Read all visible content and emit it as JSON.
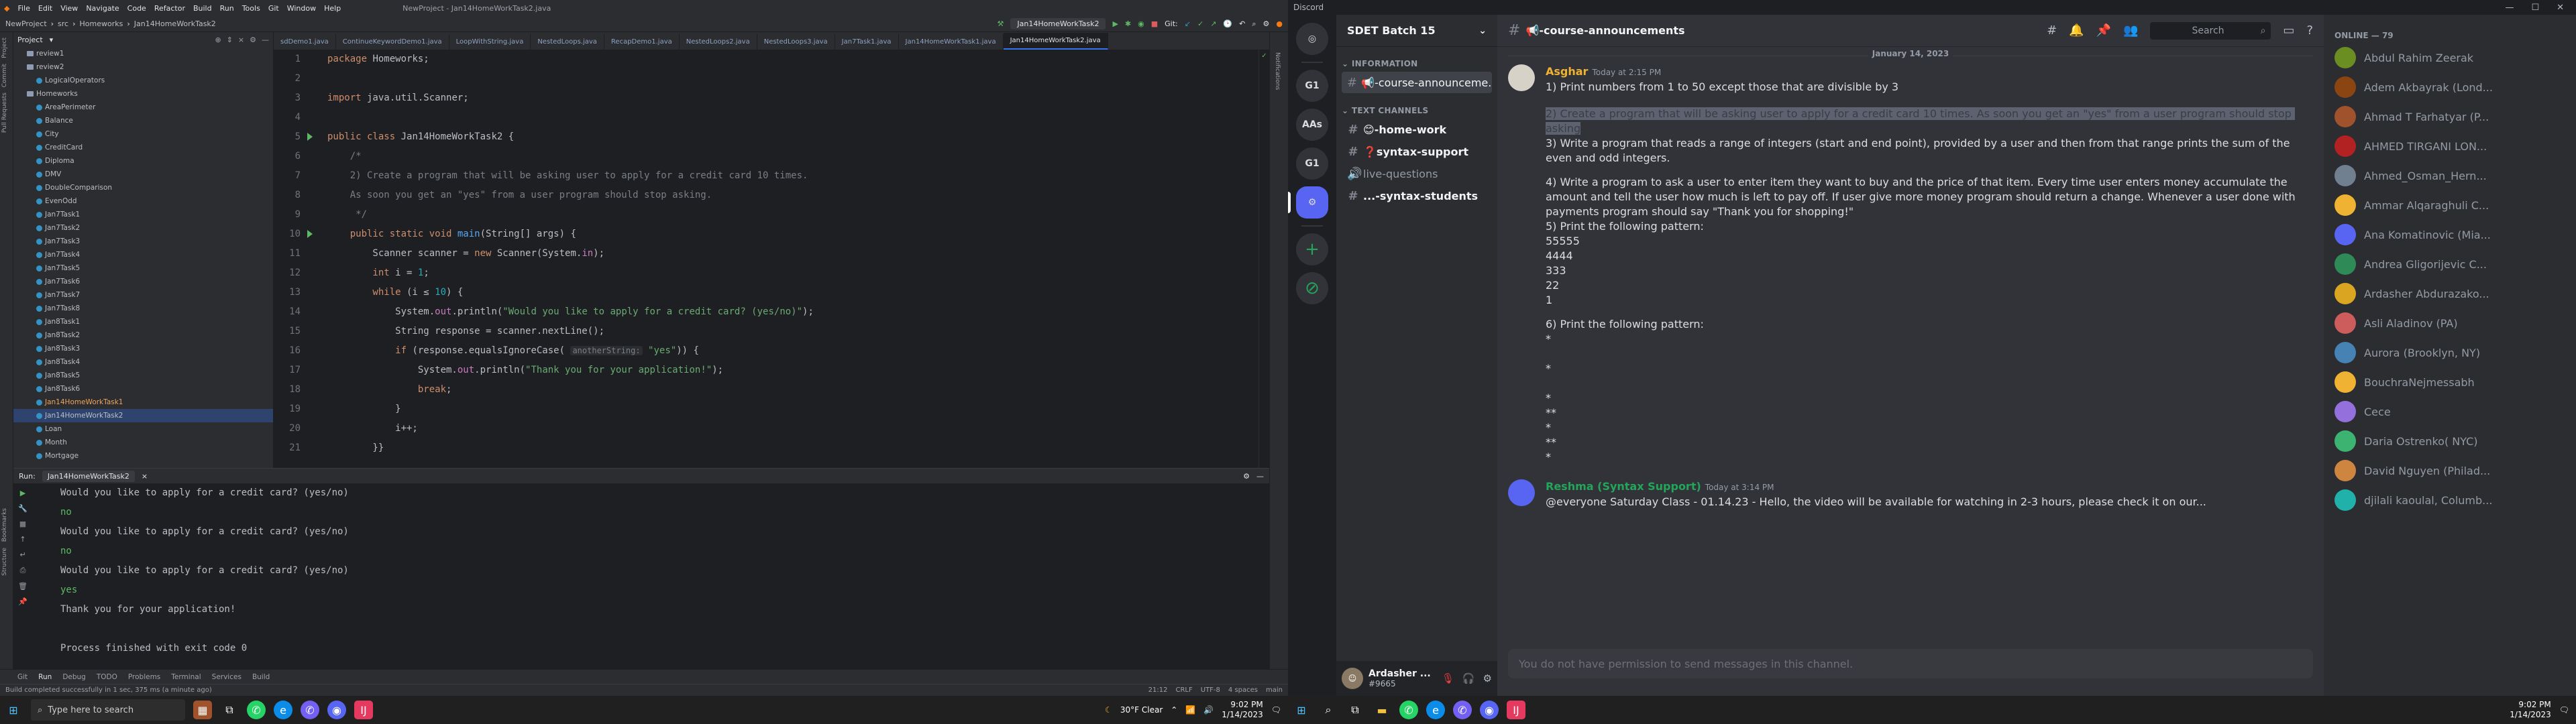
{
  "ide": {
    "window_title": "NewProject - Jan14HomeWorkTask2.java",
    "menu": [
      "File",
      "Edit",
      "View",
      "Navigate",
      "Code",
      "Refactor",
      "Build",
      "Run",
      "Tools",
      "Git",
      "Window",
      "Help"
    ],
    "breadcrumb": [
      "NewProject",
      "src",
      "Homeworks",
      "Jan14HomeWorkTask2"
    ],
    "run_config": "Jan14HomeWorkTask2",
    "git_label": "Git:",
    "project_label": "Project",
    "tree": [
      {
        "name": "review1",
        "type": "folder",
        "indent": 2
      },
      {
        "name": "review2",
        "type": "folder",
        "indent": 2
      },
      {
        "name": "LogicalOperators",
        "type": "file",
        "indent": 4
      },
      {
        "name": "Homeworks",
        "type": "folder",
        "indent": 2
      },
      {
        "name": "AreaPerimeter",
        "type": "file",
        "indent": 4
      },
      {
        "name": "Balance",
        "type": "file",
        "indent": 4
      },
      {
        "name": "City",
        "type": "file",
        "indent": 4
      },
      {
        "name": "CreditCard",
        "type": "file",
        "indent": 4
      },
      {
        "name": "Diploma",
        "type": "file",
        "indent": 4
      },
      {
        "name": "DMV",
        "type": "file",
        "indent": 4
      },
      {
        "name": "DoubleComparison",
        "type": "file",
        "indent": 4
      },
      {
        "name": "EvenOdd",
        "type": "file",
        "indent": 4
      },
      {
        "name": "Jan7Task1",
        "type": "file",
        "indent": 4
      },
      {
        "name": "Jan7Task2",
        "type": "file",
        "indent": 4
      },
      {
        "name": "Jan7Task3",
        "type": "file",
        "indent": 4
      },
      {
        "name": "Jan7Task4",
        "type": "file",
        "indent": 4
      },
      {
        "name": "Jan7Task5",
        "type": "file",
        "indent": 4
      },
      {
        "name": "Jan7Task6",
        "type": "file",
        "indent": 4
      },
      {
        "name": "Jan7Task7",
        "type": "file",
        "indent": 4
      },
      {
        "name": "Jan7Task8",
        "type": "file",
        "indent": 4
      },
      {
        "name": "Jan8Task1",
        "type": "file",
        "indent": 4
      },
      {
        "name": "Jan8Task2",
        "type": "file",
        "indent": 4
      },
      {
        "name": "Jan8Task3",
        "type": "file",
        "indent": 4
      },
      {
        "name": "Jan8Task4",
        "type": "file",
        "indent": 4
      },
      {
        "name": "Jan8Task5",
        "type": "file",
        "indent": 4
      },
      {
        "name": "Jan8Task6",
        "type": "file",
        "indent": 4
      },
      {
        "name": "Jan14HomeWorkTask1",
        "type": "file",
        "indent": 4,
        "hl": true
      },
      {
        "name": "Jan14HomeWorkTask2",
        "type": "file",
        "indent": 4,
        "sel": true
      },
      {
        "name": "Loan",
        "type": "file",
        "indent": 4
      },
      {
        "name": "Month",
        "type": "file",
        "indent": 4
      },
      {
        "name": "Mortgage",
        "type": "file",
        "indent": 4
      }
    ],
    "tabs": [
      "sdDemo1.java",
      "ContinueKeywordDemo1.java",
      "LoopWithString.java",
      "NestedLoops.java",
      "RecapDemo1.java",
      "NestedLoops2.java",
      "NestedLoops3.java",
      "Jan7Task1.java",
      "Jan14HomeWorkTask1.java",
      "Jan14HomeWorkTask2.java"
    ],
    "active_tab": "Jan14HomeWorkTask2.java",
    "line_numbers": [
      "1",
      "2",
      "3",
      "4",
      "5",
      "6",
      "7",
      "8",
      "9",
      "10",
      "11",
      "12",
      "13",
      "14",
      "15",
      "16",
      "17",
      "18",
      "19",
      "20",
      "21"
    ],
    "code": {
      "l1_kw": "package",
      "l1_rest": " Homeworks;",
      "l3_kw": "import",
      "l3_rest": " java.util.Scanner;",
      "l5_kw": "public class",
      "l5_rest": " Jan14HomeWorkTask2 {",
      "l6": "    /*",
      "l7": "    2) Create a program that will be asking user to apply for a credit card 10 times.",
      "l8": "    As soon you get an \"yes\" from a user program should stop asking.",
      "l9": "     */",
      "l10_kw": "    public static void",
      "l10_fn": " main",
      "l10_rest": "(String[] args) {",
      "l11_a": "        Scanner scanner = ",
      "l11_kw": "new",
      "l11_b": " Scanner(System.",
      "l11_fld": "in",
      "l11_c": ");",
      "l12_kw": "        int",
      "l12_a": " i = ",
      "l12_num": "1",
      "l12_b": ";",
      "l13_kw": "        while",
      "l13_a": " (i ≤ ",
      "l13_num": "10",
      "l13_b": ") {",
      "l14_a": "            System.",
      "l14_fld": "out",
      "l14_b": ".println(",
      "l14_str": "\"Would you like to apply for a credit card? (yes/no)\"",
      "l14_c": ");",
      "l15": "            String response = scanner.nextLine();",
      "l16_kw": "            if",
      "l16_a": " (response.equalsIgnoreCase( ",
      "l16_hint": "anotherString:",
      "l16_str": " \"yes\"",
      "l16_b": ")) {",
      "l17_a": "                System.",
      "l17_fld": "out",
      "l17_b": ".println(",
      "l17_str": "\"Thank you for your application!\"",
      "l17_c": ");",
      "l18_kw": "                break",
      "l18_b": ";",
      "l19": "            }",
      "l20": "            i++;",
      "l21": "        }}"
    },
    "run_title": "Run:",
    "run_tab": "Jan14HomeWorkTask2",
    "console": [
      {
        "t": "Would you like to apply for a credit card? (yes/no)",
        "in": false
      },
      {
        "t": "no",
        "in": true
      },
      {
        "t": "Would you like to apply for a credit card? (yes/no)",
        "in": false
      },
      {
        "t": "no",
        "in": true
      },
      {
        "t": "Would you like to apply for a credit card? (yes/no)",
        "in": false
      },
      {
        "t": "yes",
        "in": true
      },
      {
        "t": "Thank you for your application!",
        "in": false
      },
      {
        "t": "",
        "in": false
      },
      {
        "t": "Process finished with exit code 0",
        "in": false
      }
    ],
    "bottom_tabs": [
      "Git",
      "Run",
      "Debug",
      "TODO",
      "Problems",
      "Terminal",
      "Services",
      "Build"
    ],
    "status_left": "Build completed successfully in 1 sec, 375 ms (a minute ago)",
    "status_right": [
      "21:12",
      "CRLF",
      "UTF-8",
      "4 spaces",
      "main"
    ],
    "side_left": [
      "Project",
      "Commit",
      "Pull Requests",
      "Bookmarks",
      "Structure"
    ],
    "side_right": [
      "Notifications"
    ]
  },
  "taskbar_left": {
    "search_placeholder": "Type here to search",
    "weather": "30°F  Clear",
    "time": "9:02 PM",
    "date": "1/14/2023"
  },
  "discord": {
    "app_title": "Discord",
    "server_name": "SDET Batch 15",
    "servers": [
      "G1",
      "AAs",
      "G1"
    ],
    "categories": {
      "info": "INFORMATION",
      "text": "TEXT CHANNELS"
    },
    "channels": [
      {
        "name": "📢-course-announceme...",
        "section": "info",
        "sel": true,
        "prefix": "#"
      },
      {
        "name": "😊-home-work",
        "section": "text",
        "unread": true,
        "prefix": "#"
      },
      {
        "name": "❓syntax-support",
        "section": "text",
        "unread": true,
        "prefix": "#"
      },
      {
        "name": "live-questions",
        "section": "text",
        "prefix": "🔊"
      },
      {
        "name": "...-syntax-students",
        "section": "text",
        "unread": true,
        "prefix": "#"
      }
    ],
    "user": {
      "name": "Ardasher ...",
      "tag": "#9665"
    },
    "channel_title": "📢-course-announcements",
    "search_placeholder": "Search",
    "date_divider": "January 14, 2023",
    "msg1": {
      "author": "Asghar",
      "time": "Today at 2:15 PM",
      "line1": "1) Print numbers from 1 to 50 except those that are divisible by 3",
      "line2": "2) Create a program that will be asking user to apply for a credit card 10 times. As soon you get an \"yes\" from a user program should stop asking",
      "line3": "3) Write a program that reads a range of integers (start and end point), provided by a user and then from that range prints the sum of the even and odd integers.",
      "line4": "4) Write a program to ask a user to enter item they want to buy and the price of that item. Every time user enters money accumulate the amount and tell the user how much is left to pay off. If user give more money program should return a change. Whenever a user done with payments program should say \"Thank you for shopping!\"",
      "line5": "5) Print the following pattern:\n55555\n4444\n333\n22\n1",
      "line6": "6) Print the following pattern:\n*\n\n*\n\n*\n**\n*\n**\n*"
    },
    "msg2": {
      "author": "Reshma (Syntax Support)",
      "time": "Today at 3:14 PM",
      "text": "@everyone Saturday Class - 01.14.23 - Hello, the video will be available for watching in 2-3 hours, please check it on our..."
    },
    "input_placeholder": "You do not have permission to send messages in this channel.",
    "members_header": "ONLINE — 79",
    "members": [
      "Abdul Rahim Zeerak",
      "Adem Akbayrak (Lond...",
      "Ahmad T Farhatyar (P...",
      "AHMED TIRGANI LON...",
      "Ahmed_Osman_Hern...",
      "Ammar Alqaraghuli C...",
      "Ana Komatinovic (Mia...",
      "Andrea Gligorijevic C...",
      "Ardasher Abdurazako...",
      "Asli Aladinov (PA)",
      "Aurora (Brooklyn, NY)",
      "BouchraNejmessabh",
      "Cece",
      "Daria Ostrenko( NYC)",
      "David Nguyen (Philad...",
      "djilali kaoulal, Columb..."
    ],
    "member_colors": [
      "#6b8e23",
      "#8b4513",
      "#a0522d",
      "#b22222",
      "#708090",
      "#f0b232",
      "#5865f2",
      "#2e8b57",
      "#daa520",
      "#cd5c5c",
      "#4682b4",
      "#f0b232",
      "#9370db",
      "#3cb371",
      "#cd853f",
      "#20b2aa"
    ]
  },
  "taskbar_right": {
    "time": "9:02 PM",
    "date": "1/14/2023"
  }
}
